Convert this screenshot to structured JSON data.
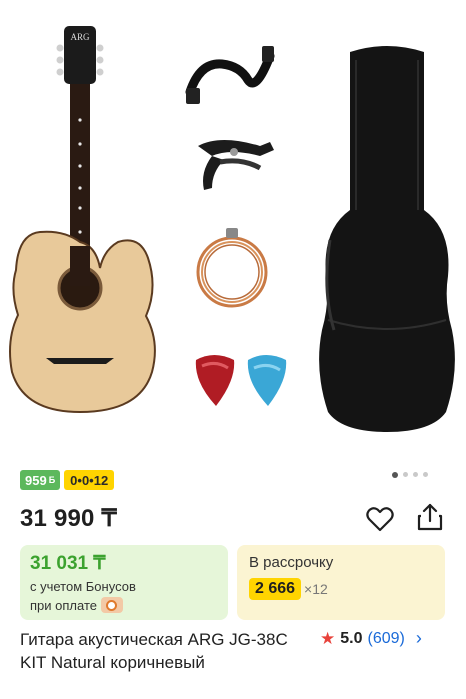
{
  "gallery": {
    "guitar_logo": "ARG",
    "page_dots": 4,
    "active_dot": 0,
    "items": [
      "guitar-image",
      "strap-image",
      "capo-image",
      "strings-image",
      "picks-image",
      "gig-bag-image"
    ]
  },
  "badges": {
    "bonus": "959",
    "bonus_icon": "Б",
    "installment": "0•0•12"
  },
  "price": "31 990 ₸",
  "bonus_card": {
    "amount": "31 031 ₸",
    "line1": "с учетом Бонусов",
    "line2": "при оплате"
  },
  "installment_card": {
    "title": "В рассрочку",
    "monthly": "2 666",
    "times": "×12"
  },
  "product": {
    "name": "Гитара акустическая ARG JG-38C KIT Natural коричневый"
  },
  "rating": {
    "score": "5.0",
    "count": "(609)"
  },
  "colors": {
    "bonus_green": "#5cb85c",
    "installment_yellow": "#ffd400",
    "link_blue": "#1a6ad8",
    "star_red": "#e8423b"
  }
}
